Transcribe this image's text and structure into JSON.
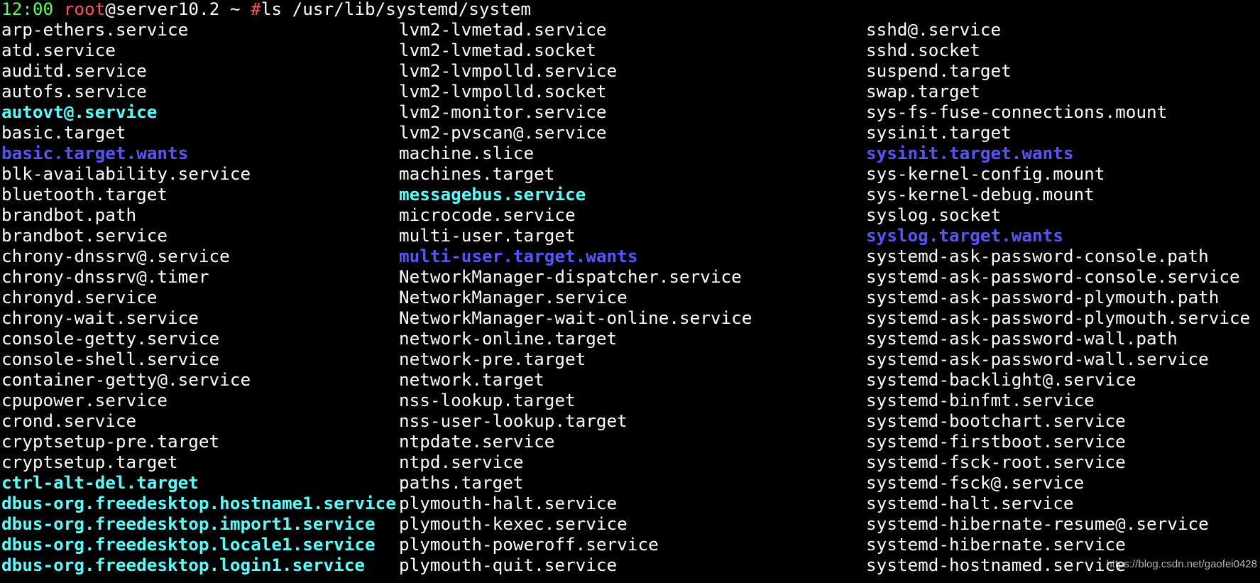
{
  "prompt": {
    "time": "12:00",
    "user": "root",
    "host": "@server10.2 ~ ",
    "hash": "#",
    "command": "ls /usr/lib/systemd/system"
  },
  "colors": {
    "background": "#000000",
    "regular_file": "#ffffff",
    "symlink": "#55ffff",
    "directory": "#5555ff",
    "prompt_time": "#55ff55",
    "prompt_user": "#ff5555"
  },
  "listing": {
    "columns": [
      [
        {
          "name": "arp-ethers.service",
          "kind": "file"
        },
        {
          "name": "atd.service",
          "kind": "file"
        },
        {
          "name": "auditd.service",
          "kind": "file"
        },
        {
          "name": "autofs.service",
          "kind": "file"
        },
        {
          "name": "autovt@.service",
          "kind": "link"
        },
        {
          "name": "basic.target",
          "kind": "file"
        },
        {
          "name": "basic.target.wants",
          "kind": "dir"
        },
        {
          "name": "blk-availability.service",
          "kind": "file"
        },
        {
          "name": "bluetooth.target",
          "kind": "file"
        },
        {
          "name": "brandbot.path",
          "kind": "file"
        },
        {
          "name": "brandbot.service",
          "kind": "file"
        },
        {
          "name": "chrony-dnssrv@.service",
          "kind": "file"
        },
        {
          "name": "chrony-dnssrv@.timer",
          "kind": "file"
        },
        {
          "name": "chronyd.service",
          "kind": "file"
        },
        {
          "name": "chrony-wait.service",
          "kind": "file"
        },
        {
          "name": "console-getty.service",
          "kind": "file"
        },
        {
          "name": "console-shell.service",
          "kind": "file"
        },
        {
          "name": "container-getty@.service",
          "kind": "file"
        },
        {
          "name": "cpupower.service",
          "kind": "file"
        },
        {
          "name": "crond.service",
          "kind": "file"
        },
        {
          "name": "cryptsetup-pre.target",
          "kind": "file"
        },
        {
          "name": "cryptsetup.target",
          "kind": "file"
        },
        {
          "name": "ctrl-alt-del.target",
          "kind": "link"
        },
        {
          "name": "dbus-org.freedesktop.hostname1.service",
          "kind": "link"
        },
        {
          "name": "dbus-org.freedesktop.import1.service",
          "kind": "link"
        },
        {
          "name": "dbus-org.freedesktop.locale1.service",
          "kind": "link"
        },
        {
          "name": "dbus-org.freedesktop.login1.service",
          "kind": "link"
        }
      ],
      [
        {
          "name": "lvm2-lvmetad.service",
          "kind": "file"
        },
        {
          "name": "lvm2-lvmetad.socket",
          "kind": "file"
        },
        {
          "name": "lvm2-lvmpolld.service",
          "kind": "file"
        },
        {
          "name": "lvm2-lvmpolld.socket",
          "kind": "file"
        },
        {
          "name": "lvm2-monitor.service",
          "kind": "file"
        },
        {
          "name": "lvm2-pvscan@.service",
          "kind": "file"
        },
        {
          "name": "machine.slice",
          "kind": "file"
        },
        {
          "name": "machines.target",
          "kind": "file"
        },
        {
          "name": "messagebus.service",
          "kind": "link"
        },
        {
          "name": "microcode.service",
          "kind": "file"
        },
        {
          "name": "multi-user.target",
          "kind": "file"
        },
        {
          "name": "multi-user.target.wants",
          "kind": "dir"
        },
        {
          "name": "NetworkManager-dispatcher.service",
          "kind": "file"
        },
        {
          "name": "NetworkManager.service",
          "kind": "file"
        },
        {
          "name": "NetworkManager-wait-online.service",
          "kind": "file"
        },
        {
          "name": "network-online.target",
          "kind": "file"
        },
        {
          "name": "network-pre.target",
          "kind": "file"
        },
        {
          "name": "network.target",
          "kind": "file"
        },
        {
          "name": "nss-lookup.target",
          "kind": "file"
        },
        {
          "name": "nss-user-lookup.target",
          "kind": "file"
        },
        {
          "name": "ntpdate.service",
          "kind": "file"
        },
        {
          "name": "ntpd.service",
          "kind": "file"
        },
        {
          "name": "paths.target",
          "kind": "file"
        },
        {
          "name": "plymouth-halt.service",
          "kind": "file"
        },
        {
          "name": "plymouth-kexec.service",
          "kind": "file"
        },
        {
          "name": "plymouth-poweroff.service",
          "kind": "file"
        },
        {
          "name": "plymouth-quit.service",
          "kind": "file"
        }
      ],
      [
        {
          "name": "sshd@.service",
          "kind": "file"
        },
        {
          "name": "sshd.socket",
          "kind": "file"
        },
        {
          "name": "suspend.target",
          "kind": "file"
        },
        {
          "name": "swap.target",
          "kind": "file"
        },
        {
          "name": "sys-fs-fuse-connections.mount",
          "kind": "file"
        },
        {
          "name": "sysinit.target",
          "kind": "file"
        },
        {
          "name": "sysinit.target.wants",
          "kind": "dir"
        },
        {
          "name": "sys-kernel-config.mount",
          "kind": "file"
        },
        {
          "name": "sys-kernel-debug.mount",
          "kind": "file"
        },
        {
          "name": "syslog.socket",
          "kind": "file"
        },
        {
          "name": "syslog.target.wants",
          "kind": "dir"
        },
        {
          "name": "systemd-ask-password-console.path",
          "kind": "file"
        },
        {
          "name": "systemd-ask-password-console.service",
          "kind": "file"
        },
        {
          "name": "systemd-ask-password-plymouth.path",
          "kind": "file"
        },
        {
          "name": "systemd-ask-password-plymouth.service",
          "kind": "file"
        },
        {
          "name": "systemd-ask-password-wall.path",
          "kind": "file"
        },
        {
          "name": "systemd-ask-password-wall.service",
          "kind": "file"
        },
        {
          "name": "systemd-backlight@.service",
          "kind": "file"
        },
        {
          "name": "systemd-binfmt.service",
          "kind": "file"
        },
        {
          "name": "systemd-bootchart.service",
          "kind": "file"
        },
        {
          "name": "systemd-firstboot.service",
          "kind": "file"
        },
        {
          "name": "systemd-fsck-root.service",
          "kind": "file"
        },
        {
          "name": "systemd-fsck@.service",
          "kind": "file"
        },
        {
          "name": "systemd-halt.service",
          "kind": "file"
        },
        {
          "name": "systemd-hibernate-resume@.service",
          "kind": "file"
        },
        {
          "name": "systemd-hibernate.service",
          "kind": "file"
        },
        {
          "name": "systemd-hostnamed.service",
          "kind": "file"
        }
      ]
    ]
  },
  "watermark": "https://blog.csdn.net/gaofei0428"
}
